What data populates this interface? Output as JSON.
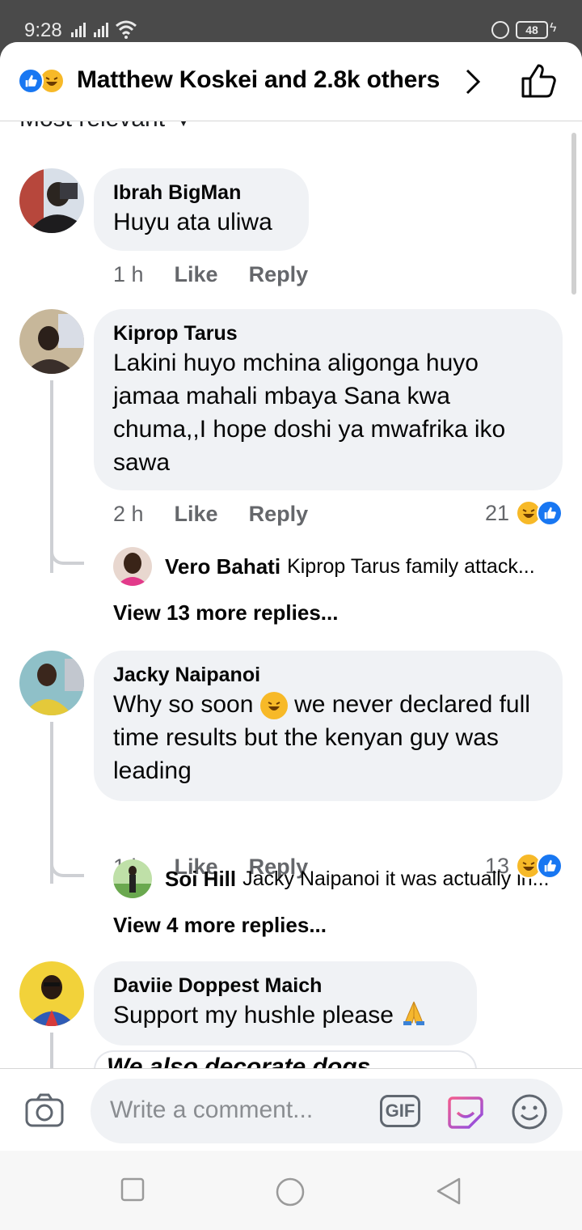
{
  "status_bar": {
    "time": "9:28",
    "battery": "48"
  },
  "header": {
    "likers_text": "Matthew Koskei and 2.8k others"
  },
  "sort_label": "Most relevant",
  "comments": [
    {
      "name": "Ibrah BigMan",
      "text": "Huyu ata uliwa",
      "age": "1 h",
      "like_label": "Like",
      "reply_label": "Reply"
    },
    {
      "name": "Kiprop Tarus",
      "text": "Lakini huyo mchina aligonga huyo jamaa mahali mbaya Sana kwa chuma,,I hope doshi ya mwafrika iko sawa",
      "age": "2 h",
      "like_label": "Like",
      "reply_label": "Reply",
      "reaction_count": "21",
      "reply_preview": {
        "name": "Vero Bahati",
        "text": "Kiprop Tarus family attack..."
      },
      "view_more": "View 13 more replies..."
    },
    {
      "name": "Jacky Naipanoi",
      "text_before_emoji": "Why so soon",
      "text_after_emoji": "we never declared full time results but the kenyan guy was leading",
      "age": "1 h",
      "like_label": "Like",
      "reply_label": "Reply",
      "reaction_count": "13",
      "reply_preview": {
        "name": "Soi Hill",
        "text": "Jacky Naipanoi it was actually in..."
      },
      "view_more": "View 4 more replies..."
    },
    {
      "name": "Daviie Doppest Maich",
      "text": "Support my hushle please",
      "partial_text": "We also decorate dogs"
    }
  ],
  "composer": {
    "placeholder": "Write a comment...",
    "gif_label": "GIF"
  },
  "icons": {
    "like_reaction": "like-reaction-icon",
    "haha_reaction": "haha-reaction-icon",
    "thumbs_up": "thumbs-up-icon",
    "camera": "camera-icon",
    "sticker": "sticker-icon",
    "emoji": "emoji-icon",
    "pray": "pray-emoji"
  },
  "colors": {
    "facebook_blue": "#1877f2",
    "haha_yellow": "#f7b928",
    "bubble_gray": "#f0f2f5",
    "meta_gray": "#65676b"
  }
}
